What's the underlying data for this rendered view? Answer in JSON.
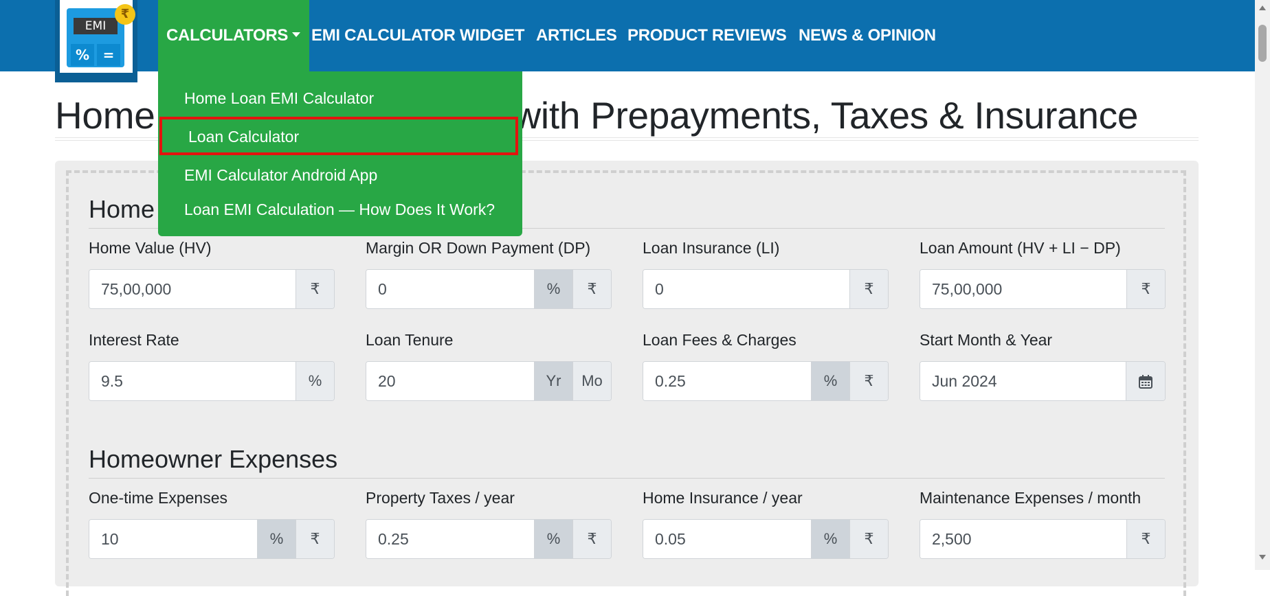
{
  "logo": {
    "screen_text": "EMI",
    "coin": "₹",
    "btn_left": "%",
    "btn_right": "="
  },
  "nav": {
    "calculators": "CALCULATORS",
    "widget": "EMI CALCULATOR WIDGET",
    "articles": "ARTICLES",
    "reviews": "PRODUCT REVIEWS",
    "news": "NEWS & OPINION"
  },
  "dropdown": {
    "items": [
      {
        "label": "Home Loan EMI Calculator"
      },
      {
        "label": "Loan Calculator"
      },
      {
        "label": "EMI Calculator Android App"
      },
      {
        "label": "Loan EMI Calculation — How Does It Work?"
      }
    ]
  },
  "page": {
    "title_left": "Home",
    "title_right": "with Prepayments, Taxes & Insurance"
  },
  "sections": {
    "home": "Home",
    "expenses": "Homeowner Expenses"
  },
  "fields": {
    "home_value": {
      "label": "Home Value (HV)",
      "value": "75,00,000",
      "addon": "₹"
    },
    "down_payment": {
      "label": "Margin OR Down Payment (DP)",
      "value": "0",
      "addon1": "%",
      "addon2": "₹"
    },
    "loan_insurance": {
      "label": "Loan Insurance (LI)",
      "value": "0",
      "addon": "₹"
    },
    "loan_amount": {
      "label": "Loan Amount (HV + LI − DP)",
      "value": "75,00,000",
      "addon": "₹"
    },
    "interest_rate": {
      "label": "Interest Rate",
      "value": "9.5",
      "addon": "%"
    },
    "loan_tenure": {
      "label": "Loan Tenure",
      "value": "20",
      "addon1": "Yr",
      "addon2": "Mo"
    },
    "loan_fees": {
      "label": "Loan Fees & Charges",
      "value": "0.25",
      "addon1": "%",
      "addon2": "₹"
    },
    "start_month": {
      "label": "Start Month & Year",
      "value": "Jun 2024"
    },
    "one_time": {
      "label": "One-time Expenses",
      "value": "10",
      "addon1": "%",
      "addon2": "₹"
    },
    "property_taxes": {
      "label": "Property Taxes / year",
      "value": "0.25",
      "addon1": "%",
      "addon2": "₹"
    },
    "home_insurance": {
      "label": "Home Insurance / year",
      "value": "0.05",
      "addon1": "%",
      "addon2": "₹"
    },
    "maintenance": {
      "label": "Maintenance Expenses / month",
      "value": "2,500",
      "addon": "₹"
    }
  },
  "colors": {
    "nav_bg": "#0c6fae",
    "active_bg": "#28a745",
    "highlight": "#e3130e",
    "panel_bg": "#ededed"
  }
}
